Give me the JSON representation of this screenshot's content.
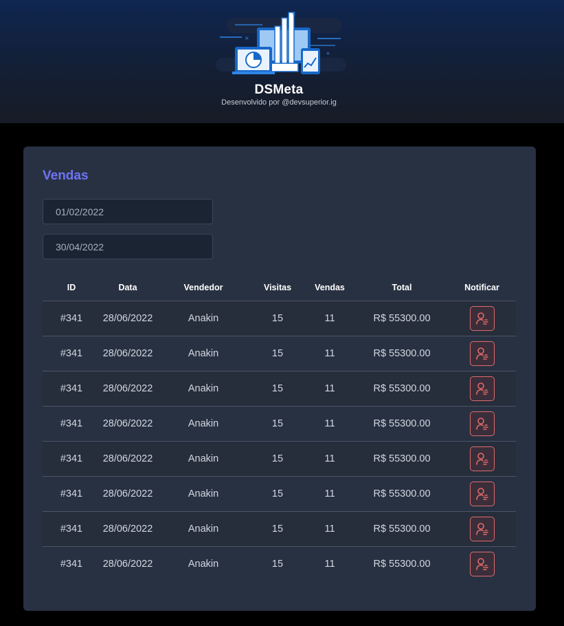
{
  "brand": {
    "title": "DSMeta",
    "subtitle": "Desenvolvido por @devsuperior.ig",
    "logo_icon": "dashboard-devices-icon"
  },
  "sales": {
    "title": "Vendas",
    "min_date": "01/02/2022",
    "max_date": "30/04/2022",
    "columns": [
      "ID",
      "Data",
      "Vendedor",
      "Visitas",
      "Vendas",
      "Total",
      "Notificar"
    ],
    "rows": [
      {
        "id": "#341",
        "date": "28/06/2022",
        "seller": "Anakin",
        "visits": "15",
        "deals": "11",
        "total": "R$ 55300.00"
      },
      {
        "id": "#341",
        "date": "28/06/2022",
        "seller": "Anakin",
        "visits": "15",
        "deals": "11",
        "total": "R$ 55300.00"
      },
      {
        "id": "#341",
        "date": "28/06/2022",
        "seller": "Anakin",
        "visits": "15",
        "deals": "11",
        "total": "R$ 55300.00"
      },
      {
        "id": "#341",
        "date": "28/06/2022",
        "seller": "Anakin",
        "visits": "15",
        "deals": "11",
        "total": "R$ 55300.00"
      },
      {
        "id": "#341",
        "date": "28/06/2022",
        "seller": "Anakin",
        "visits": "15",
        "deals": "11",
        "total": "R$ 55300.00"
      },
      {
        "id": "#341",
        "date": "28/06/2022",
        "seller": "Anakin",
        "visits": "15",
        "deals": "11",
        "total": "R$ 55300.00"
      },
      {
        "id": "#341",
        "date": "28/06/2022",
        "seller": "Anakin",
        "visits": "15",
        "deals": "11",
        "total": "R$ 55300.00"
      },
      {
        "id": "#341",
        "date": "28/06/2022",
        "seller": "Anakin",
        "visits": "15",
        "deals": "11",
        "total": "R$ 55300.00"
      }
    ],
    "notify_icon": "user-notify-icon"
  },
  "colors": {
    "accent": "#6f75f5",
    "notify": "#e06b6b",
    "card_bg": "#283142",
    "page_bg": "#000000"
  }
}
